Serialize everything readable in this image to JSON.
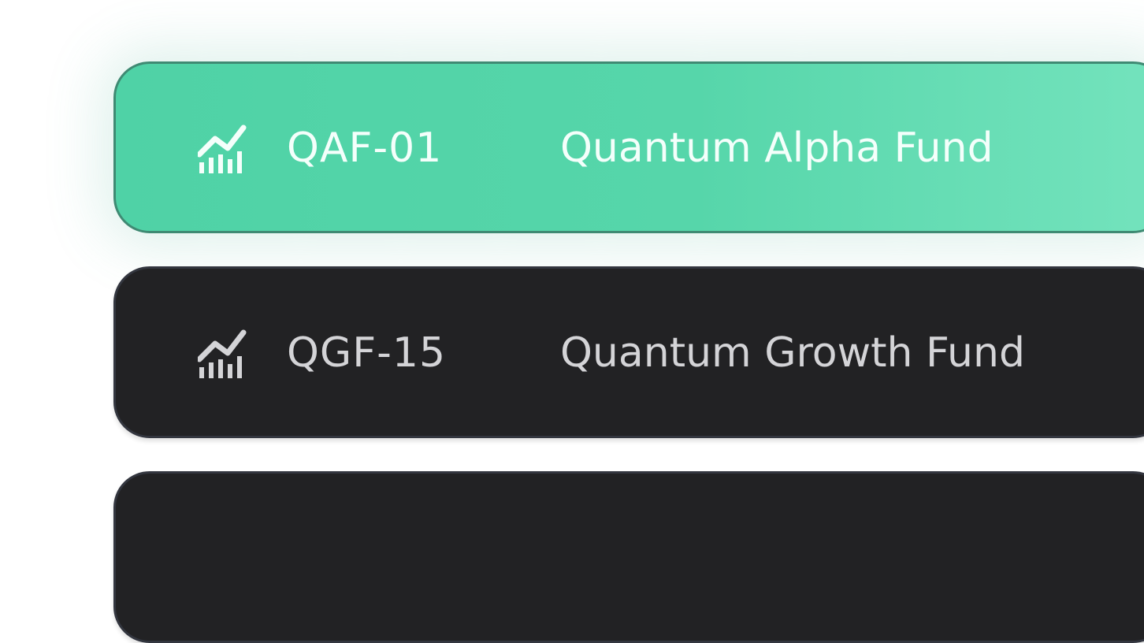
{
  "funds": [
    {
      "code": "QAF-01",
      "name": "Quantum Alpha Fund",
      "icon": "chart-trend-up-icon",
      "selected": true
    },
    {
      "code": "QGF-15",
      "name": "Quantum Growth Fund",
      "icon": "chart-trend-up-icon",
      "selected": false
    },
    {
      "icon": "chart-trend-up-icon",
      "selected": false
    }
  ],
  "colors": {
    "selected_background": "#4fd2a6",
    "selected_border": "#3f8a73",
    "row_background": "#222224",
    "row_border": "#33363f",
    "selected_text": "#f4fffb",
    "row_text": "#d4d4d7"
  }
}
